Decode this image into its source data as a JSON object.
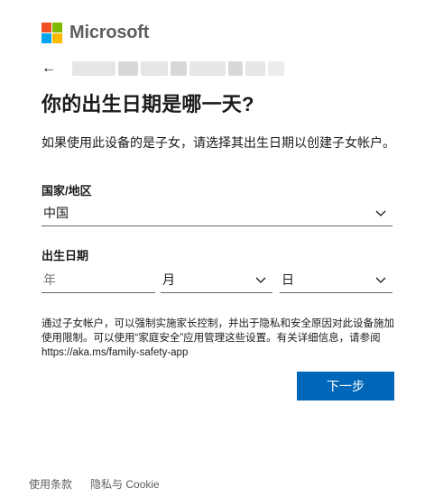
{
  "brand": {
    "name": "Microsoft",
    "logo_colors": [
      "#f25022",
      "#7fba00",
      "#00a4ef",
      "#ffb900"
    ]
  },
  "header": {
    "back_icon": "arrow-left-icon",
    "account_email": ""
  },
  "page": {
    "title": "你的出生日期是哪一天?",
    "description": "如果使用此设备的是子女，请选择其出生日期以创建子女帐户。"
  },
  "country": {
    "label": "国家/地区",
    "value": "中国"
  },
  "birthdate": {
    "label": "出生日期",
    "year_placeholder": "年",
    "month_value": "月",
    "day_value": "日"
  },
  "notice": "通过子女帐户，可以强制实施家长控制，并出于隐私和安全原因对此设备施加使用限制。可以使用“家庭安全”应用管理这些设置。有关详细信息，请参阅 https://aka.ms/family-safety-app",
  "buttons": {
    "next": "下一步"
  },
  "footer": {
    "terms": "使用条款",
    "privacy": "隐私与 Cookie"
  },
  "colors": {
    "accent": "#0067b8",
    "text": "#1b1b1b",
    "muted": "#5e5e5e"
  }
}
